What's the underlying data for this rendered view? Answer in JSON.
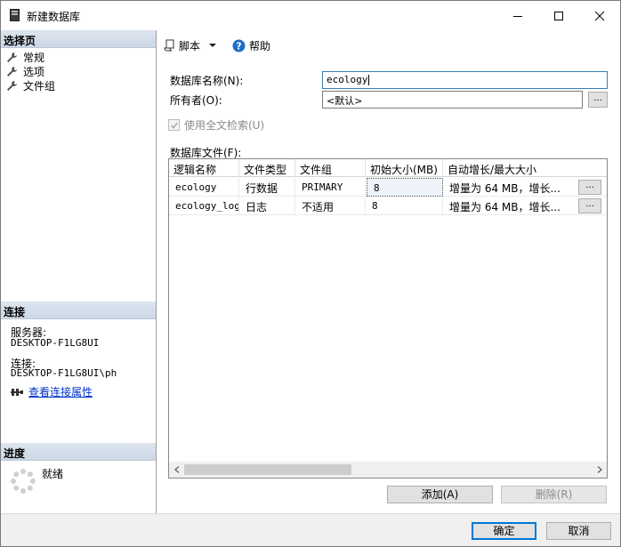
{
  "window": {
    "title": "新建数据库",
    "min_label": "minimize",
    "max_label": "maximize",
    "close_label": "close"
  },
  "left": {
    "select_page_header": "选择页",
    "pages": [
      {
        "label": "常规",
        "icon": "wrench-icon"
      },
      {
        "label": "选项",
        "icon": "wrench-icon"
      },
      {
        "label": "文件组",
        "icon": "wrench-icon"
      }
    ],
    "connection_header": "连接",
    "server_label": "服务器:",
    "server_value": "DESKTOP-F1LG8UI",
    "connection_label": "连接:",
    "connection_value": "DESKTOP-F1LG8UI\\ph",
    "view_connection_link": "查看连接属性",
    "progress_header": "进度",
    "progress_status": "就绪"
  },
  "toolbar": {
    "script_label": "脚本",
    "help_label": "帮助"
  },
  "form": {
    "db_name_label": "数据库名称(N):",
    "db_name_value": "ecology",
    "owner_label": "所有者(O):",
    "owner_value": "<默认>",
    "browse_label": "...",
    "fulltext_label": "使用全文检索(U)",
    "fulltext_checked": true,
    "files_label": "数据库文件(F):"
  },
  "grid": {
    "columns": [
      "逻辑名称",
      "文件类型",
      "文件组",
      "初始大小(MB)",
      "自动增长/最大大小"
    ],
    "rows": [
      {
        "logical_name": "ecology",
        "file_type": "行数据",
        "filegroup": "PRIMARY",
        "initial_size": "8",
        "autogrowth": "增量为 64 MB，增长...",
        "btn": "..."
      },
      {
        "logical_name": "ecology_log",
        "file_type": "日志",
        "filegroup": "不适用",
        "initial_size": "8",
        "autogrowth": "增量为 64 MB，增长...",
        "btn": "..."
      }
    ]
  },
  "actions": {
    "add_label": "添加(A)",
    "remove_label": "删除(R)",
    "ok_label": "确定",
    "cancel_label": "取消"
  },
  "colors": {
    "section_header": "#d3dde9",
    "link": "#0033cc",
    "help_icon": "#1e6ec8",
    "focus_border": "#3c7fb1",
    "default_button_border": "#0078d7"
  }
}
